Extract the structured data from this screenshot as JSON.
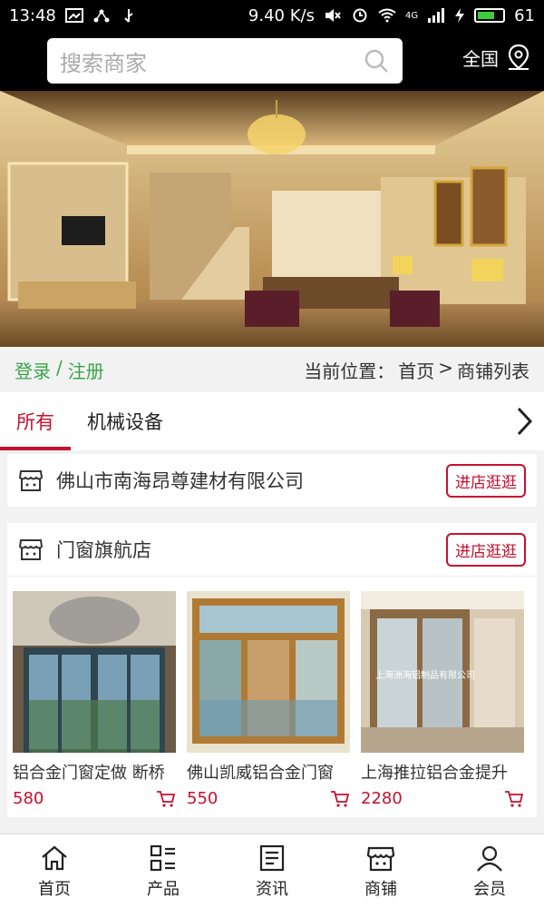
{
  "status": {
    "time": "13:48",
    "speed": "9.40 K/s",
    "network": "4G",
    "battery": "61",
    "battery_level": 0.61
  },
  "search": {
    "placeholder": "搜索商家"
  },
  "header": {
    "region": "全国"
  },
  "auth": {
    "login": "登录",
    "sep": "/",
    "register": "注册"
  },
  "breadcrumb": {
    "prefix": "当前位置：",
    "home": "首页",
    "sep": ">",
    "current": "商铺列表"
  },
  "tabs": [
    {
      "label": "所有"
    },
    {
      "label": "机械设备"
    }
  ],
  "stores": [
    {
      "name": "佛山市南海昂尊建材有限公司",
      "visit": "进店逛逛"
    },
    {
      "name": "门窗旗航店",
      "visit": "进店逛逛",
      "products": [
        {
          "name": "铝合金门窗定做 断桥",
          "price": "580"
        },
        {
          "name": "佛山凯威铝合金门窗",
          "price": "550"
        },
        {
          "name": "上海推拉铝合金提升",
          "price": "2280"
        }
      ],
      "watermark": "上海洲海铝制品有限公司"
    }
  ],
  "nav": [
    {
      "label": "首页"
    },
    {
      "label": "产品"
    },
    {
      "label": "资讯"
    },
    {
      "label": "商铺"
    },
    {
      "label": "会员"
    }
  ],
  "colors": {
    "accent": "#c8102e",
    "auth": "#3aa54a",
    "header_bg": "#000000"
  }
}
